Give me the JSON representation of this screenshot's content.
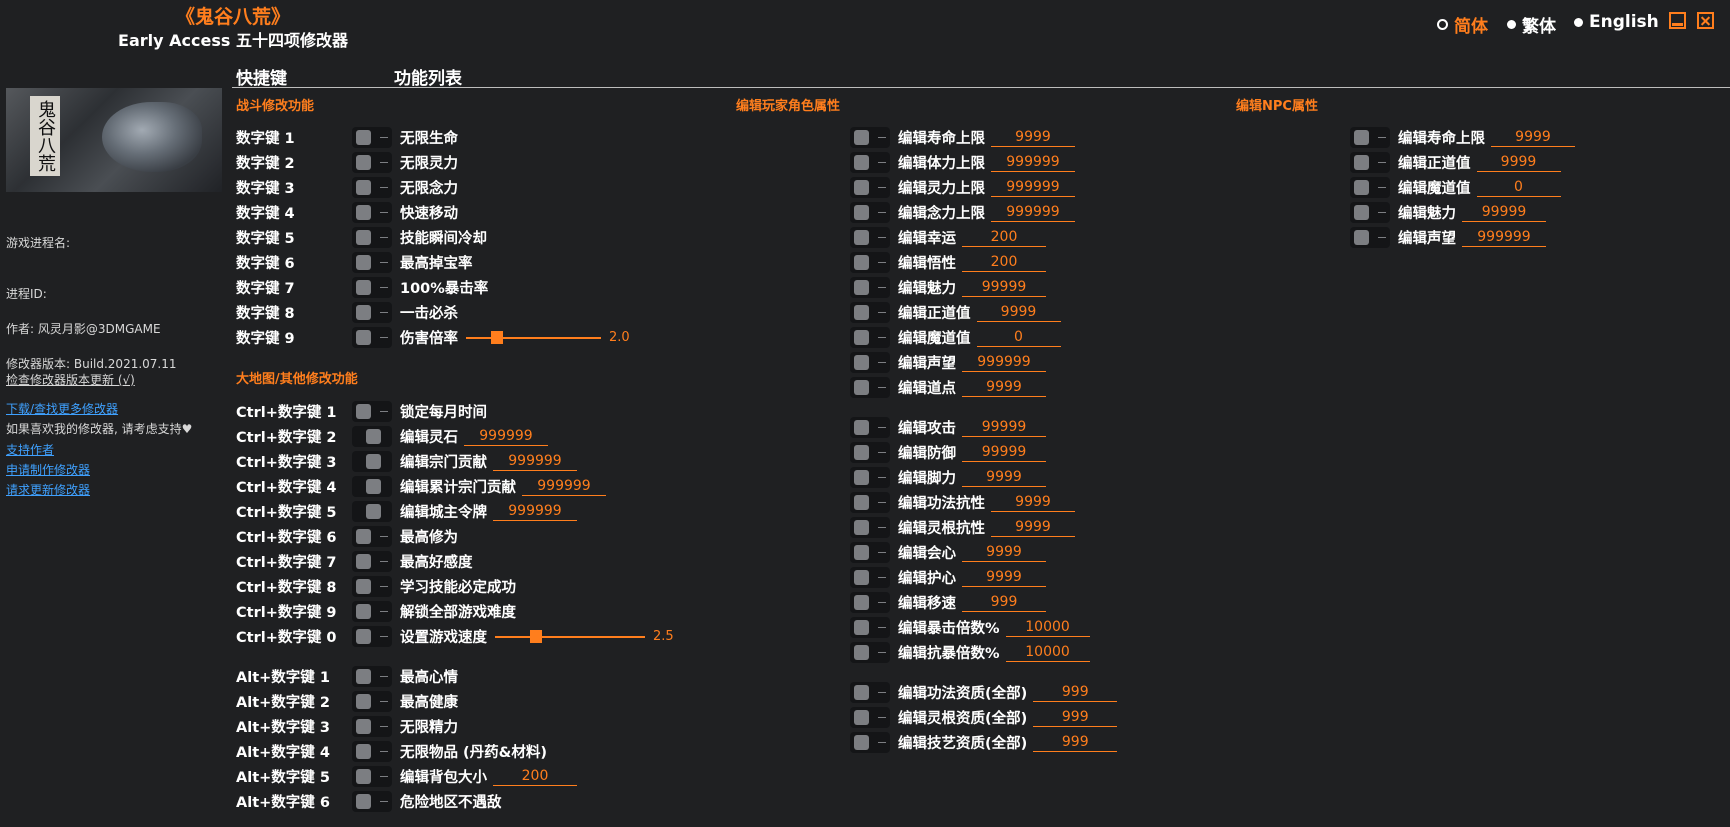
{
  "header": {
    "title": "《鬼谷八荒》",
    "subtitle": "Early Access 五十四项修改器",
    "languages": [
      "简体",
      "繁体",
      "English"
    ],
    "selected_language": "简体"
  },
  "sidebar": {
    "cover_logo_text": "鬼谷八荒",
    "process_name_label": "游戏进程名:",
    "process_id_label": "进程ID:",
    "author": "作者: 风灵月影@3DMGAME",
    "version": "修改器版本: Build.2021.07.11",
    "check_update": "检查修改器版本更新 (√)",
    "download_more": "下载/查找更多修改器",
    "support_text": "如果喜欢我的修改器, 请考虑支持♥",
    "support_author": "支持作者",
    "request_make": "申请制作修改器",
    "request_update": "请求更新修改器"
  },
  "columns": {
    "hotkey": "快捷键",
    "functions": "功能列表"
  },
  "sections": {
    "combat": "战斗修改功能",
    "map": "大地图/其他修改功能",
    "player": "编辑玩家角色属性",
    "npc": "编辑NPC属性"
  },
  "combat_rows": [
    {
      "key": "数字键 1",
      "label": "无限生命"
    },
    {
      "key": "数字键 2",
      "label": "无限灵力"
    },
    {
      "key": "数字键 3",
      "label": "无限念力"
    },
    {
      "key": "数字键 4",
      "label": "快速移动"
    },
    {
      "key": "数字键 5",
      "label": "技能瞬间冷却"
    },
    {
      "key": "数字键 6",
      "label": "最高掉宝率"
    },
    {
      "key": "数字键 7",
      "label": "100%暴击率"
    },
    {
      "key": "数字键 8",
      "label": "一击必杀"
    },
    {
      "key": "数字键 9",
      "label": "伤害倍率",
      "slider": 2.0,
      "slider_text": "2.0"
    }
  ],
  "map_rows": [
    {
      "key": "Ctrl+数字键 1",
      "label": "锁定每月时间"
    },
    {
      "key": "Ctrl+数字键 2",
      "label": "编辑灵石",
      "value": "999999"
    },
    {
      "key": "Ctrl+数字键 3",
      "label": "编辑宗门贡献",
      "value": "999999"
    },
    {
      "key": "Ctrl+数字键 4",
      "label": "编辑累计宗门贡献",
      "value": "999999"
    },
    {
      "key": "Ctrl+数字键 5",
      "label": "编辑城主令牌",
      "value": "999999"
    },
    {
      "key": "Ctrl+数字键 6",
      "label": "最高修为"
    },
    {
      "key": "Ctrl+数字键 7",
      "label": "最高好感度"
    },
    {
      "key": "Ctrl+数字键 8",
      "label": "学习技能必定成功"
    },
    {
      "key": "Ctrl+数字键 9",
      "label": "解锁全部游戏难度"
    },
    {
      "key": "Ctrl+数字键 0",
      "label": "设置游戏速度",
      "slider": 2.5,
      "slider_text": "2.5"
    }
  ],
  "alt_rows": [
    {
      "key": "Alt+数字键 1",
      "label": "最高心情"
    },
    {
      "key": "Alt+数字键 2",
      "label": "最高健康"
    },
    {
      "key": "Alt+数字键 3",
      "label": "无限精力"
    },
    {
      "key": "Alt+数字键 4",
      "label": "无限物品 (丹药&材料)"
    },
    {
      "key": "Alt+数字键 5",
      "label": "编辑背包大小",
      "value": "200"
    },
    {
      "key": "Alt+数字键 6",
      "label": "危险地区不遇敌"
    }
  ],
  "player_group1": [
    {
      "label": "编辑寿命上限",
      "value": "9999"
    },
    {
      "label": "编辑体力上限",
      "value": "999999"
    },
    {
      "label": "编辑灵力上限",
      "value": "999999"
    },
    {
      "label": "编辑念力上限",
      "value": "999999"
    },
    {
      "label": "编辑幸运",
      "value": "200"
    },
    {
      "label": "编辑悟性",
      "value": "200"
    },
    {
      "label": "编辑魅力",
      "value": "99999"
    },
    {
      "label": "编辑正道值",
      "value": "9999"
    },
    {
      "label": "编辑魔道值",
      "value": "0"
    },
    {
      "label": "编辑声望",
      "value": "999999"
    },
    {
      "label": "编辑道点",
      "value": "9999"
    }
  ],
  "player_group2": [
    {
      "label": "编辑攻击",
      "value": "99999"
    },
    {
      "label": "编辑防御",
      "value": "99999"
    },
    {
      "label": "编辑脚力",
      "value": "9999"
    },
    {
      "label": "编辑功法抗性",
      "value": "9999"
    },
    {
      "label": "编辑灵根抗性",
      "value": "9999"
    },
    {
      "label": "编辑会心",
      "value": "9999"
    },
    {
      "label": "编辑护心",
      "value": "9999"
    },
    {
      "label": "编辑移速",
      "value": "999"
    },
    {
      "label": "编辑暴击倍数%",
      "value": "10000"
    },
    {
      "label": "编辑抗暴倍数%",
      "value": "10000"
    }
  ],
  "player_group3": [
    {
      "label": "编辑功法资质(全部)",
      "value": "999"
    },
    {
      "label": "编辑灵根资质(全部)",
      "value": "999"
    },
    {
      "label": "编辑技艺资质(全部)",
      "value": "999"
    }
  ],
  "npc_rows": [
    {
      "label": "编辑寿命上限",
      "value": "9999"
    },
    {
      "label": "编辑正道值",
      "value": "9999"
    },
    {
      "label": "编辑魔道值",
      "value": "0"
    },
    {
      "label": "编辑魅力",
      "value": "99999"
    },
    {
      "label": "编辑声望",
      "value": "999999"
    }
  ],
  "colors": {
    "accent": "#ff7e1d",
    "background": "#1f2022",
    "link": "#3fa1ff"
  }
}
